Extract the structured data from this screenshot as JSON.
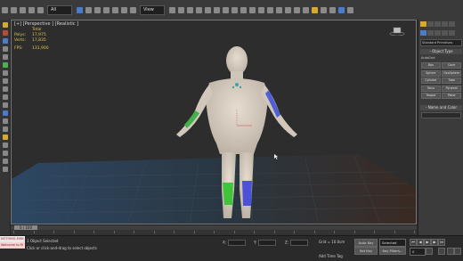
{
  "toolbar": {
    "selection_filter": "All",
    "reference_coord": "View"
  },
  "viewport": {
    "label": "[+] [Perspective ] [Realistic ]",
    "stats": {
      "header": "Total",
      "polys_label": "Polys:",
      "polys_value": "17,975",
      "verts_label": "Verts:",
      "verts_value": "17,835",
      "fps_label": "FPS:",
      "fps_value": "131,900"
    }
  },
  "command_panel": {
    "dropdown": "Standard Primitives",
    "object_type_label": "- Object Type",
    "autogrid_label": "AutoGrid",
    "buttons": [
      "Box",
      "Cone",
      "Sphere",
      "GeoSphere",
      "Cylinder",
      "Tube",
      "Torus",
      "Pyramid",
      "Teapot",
      "Plane"
    ],
    "name_color_label": "- Name and Color"
  },
  "timeslider": {
    "label": "0 / 100"
  },
  "trackbar": {
    "ticks": [
      0,
      5,
      10,
      15,
      20,
      25,
      30,
      35,
      40,
      45,
      50,
      55,
      60,
      65,
      70,
      75,
      80,
      85,
      90,
      95,
      100
    ]
  },
  "status": {
    "maxscript_line1": "NOTHING-MINI",
    "maxscript_line2": "Welcome to M",
    "selection": "1 Object Selected",
    "prompt": "Click or click-and-drag to select objects",
    "x_label": "X:",
    "y_label": "Y:",
    "z_label": "Z:",
    "grid": "Grid = 10.0cm",
    "autokey": "Auto Key",
    "setkey": "Set Key",
    "selected": "Selected",
    "key_filters": "Key Filters...",
    "add_time_tag": "Add Time Tag",
    "frame": "0"
  },
  "colors": {
    "accent": "#4a7cc9",
    "left_arm": "#43b14a",
    "right_arm": "#4f5fd6",
    "left_leg": "#3fc43a",
    "right_leg": "#4b52d8",
    "skin": "#d9cfc3",
    "stats_text": "#e0c24a"
  }
}
